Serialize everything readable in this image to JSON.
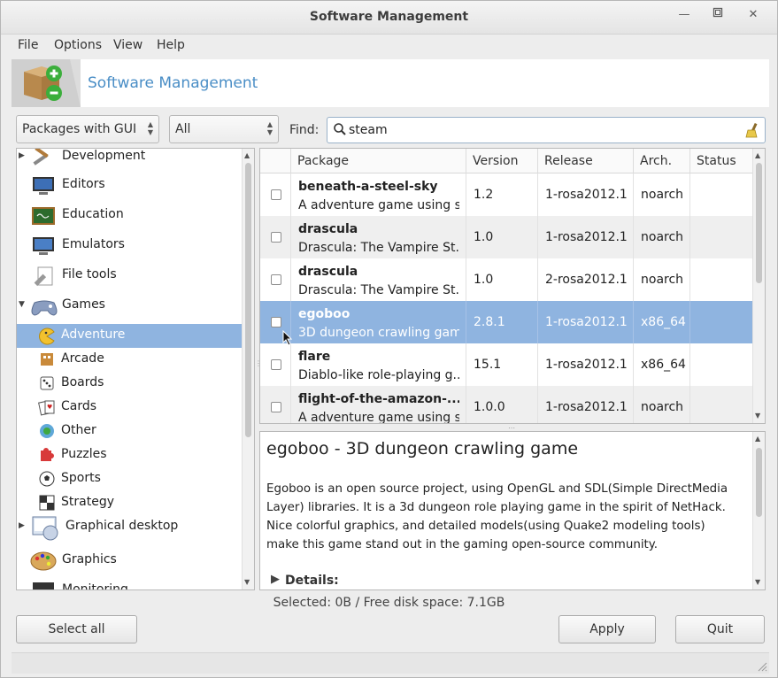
{
  "window": {
    "title": "Software Management"
  },
  "menu": [
    "File",
    "Options",
    "View",
    "Help"
  ],
  "banner": {
    "title": "Software Management"
  },
  "filters": {
    "group": "Packages with GUI",
    "state": "All",
    "find_label": "Find:",
    "search_value": "steam"
  },
  "tree": [
    {
      "label": "Development",
      "expander": "▶",
      "icon": "development-icon"
    },
    {
      "label": "Editors",
      "icon": "editors-icon"
    },
    {
      "label": "Education",
      "icon": "education-icon"
    },
    {
      "label": "Emulators",
      "icon": "emulators-icon"
    },
    {
      "label": "File tools",
      "icon": "file-tools-icon"
    },
    {
      "label": "Games",
      "expander": "▼",
      "icon": "games-icon"
    },
    {
      "label": "Adventure",
      "icon": "adventure-icon"
    },
    {
      "label": "Arcade",
      "icon": "arcade-icon"
    },
    {
      "label": "Boards",
      "icon": "boards-icon"
    },
    {
      "label": "Cards",
      "icon": "cards-icon"
    },
    {
      "label": "Other",
      "icon": "other-icon"
    },
    {
      "label": "Puzzles",
      "icon": "puzzles-icon"
    },
    {
      "label": "Sports",
      "icon": "sports-icon"
    },
    {
      "label": "Strategy",
      "icon": "strategy-icon"
    },
    {
      "label": "Graphical desktop",
      "expander": "▶",
      "icon": "graphical-desktop-icon"
    },
    {
      "label": "Graphics",
      "icon": "graphics-icon"
    },
    {
      "label": "Monitoring",
      "icon": "monitoring-icon"
    }
  ],
  "columns": [
    "Package",
    "Version",
    "Release",
    "Arch.",
    "Status"
  ],
  "packages": [
    {
      "name": "beneath-a-steel-sky",
      "summary": "A adventure game using s...",
      "version": "1.2",
      "release": "1-rosa2012.1",
      "arch": "noarch",
      "status": ""
    },
    {
      "name": "drascula",
      "summary": "Drascula: The Vampire St...",
      "version": "1.0",
      "release": "1-rosa2012.1",
      "arch": "noarch",
      "status": ""
    },
    {
      "name": "drascula",
      "summary": "Drascula: The Vampire St...",
      "version": "1.0",
      "release": "2-rosa2012.1",
      "arch": "noarch",
      "status": ""
    },
    {
      "name": "egoboo",
      "summary": "3D dungeon crawling game",
      "version": "2.8.1",
      "release": "1-rosa2012.1",
      "arch": "x86_64",
      "status": ""
    },
    {
      "name": "flare",
      "summary": "Diablo-like role-playing g...",
      "version": "15.1",
      "release": "1-rosa2012.1",
      "arch": "x86_64",
      "status": ""
    },
    {
      "name": "flight-of-the-amazon-...",
      "summary": "A adventure game using s...",
      "version": "1.0.0",
      "release": "1-rosa2012.1",
      "arch": "noarch",
      "status": ""
    }
  ],
  "description": {
    "title": "egoboo - 3D dungeon crawling game",
    "text": "Egoboo is an open source project, using OpenGL and SDL(Simple DirectMedia Layer) libraries. It is a 3d dungeon role playing game in the spirit of NetHack. Nice colorful graphics, and detailed models(using Quake2 modeling tools) make this game stand out in the gaming open-source community.",
    "details_label": "Details:"
  },
  "status_text": "Selected: 0B / Free disk space: 7.1GB",
  "buttons": {
    "select_all": "Select all",
    "apply": "Apply",
    "quit": "Quit"
  },
  "colors": {
    "selection": "#8fb4e0",
    "banner_title": "#4a8ec6"
  }
}
